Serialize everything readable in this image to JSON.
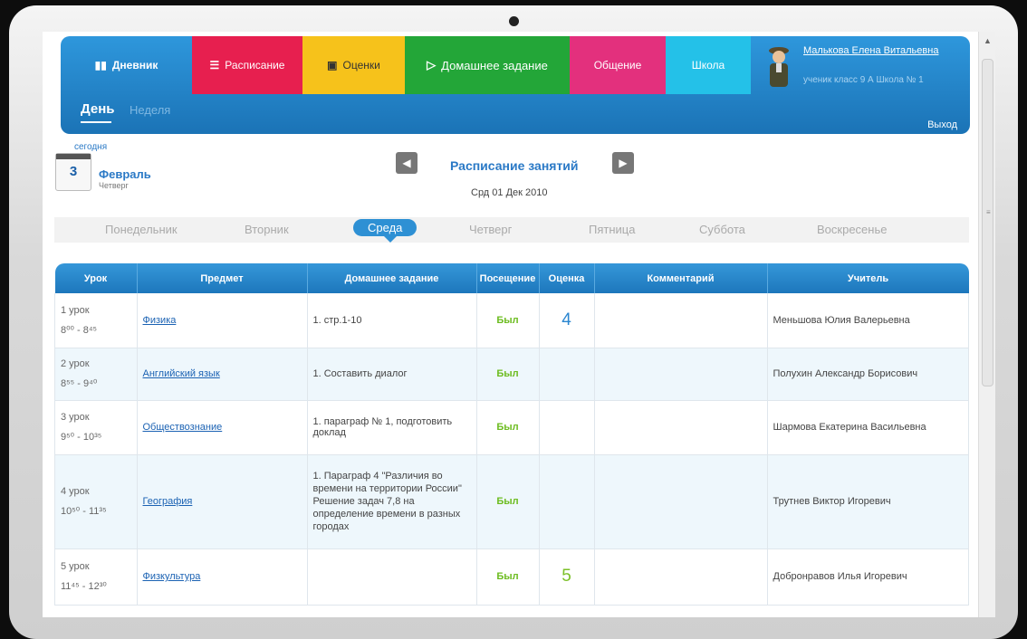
{
  "nav": {
    "tabs": [
      {
        "label": "Дневник"
      },
      {
        "label": "Расписание"
      },
      {
        "label": "Оценки"
      },
      {
        "label": "Домашнее задание"
      },
      {
        "label": "Общение"
      },
      {
        "label": "Школа"
      }
    ],
    "sub_tabs": {
      "day": "День",
      "week": "Неделя"
    },
    "user": {
      "name": "Малькова Елена Витальевна",
      "info": "ученик класс 9 А   Школа № 1"
    },
    "exit": "Выход"
  },
  "calendar": {
    "today": "сегодня",
    "day": "3",
    "month": "Февраль",
    "weekday": "Четверг"
  },
  "schedule": {
    "title": "Расписание занятий",
    "date": "Срд 01 Дек 2010"
  },
  "days": [
    {
      "label": "Понедельник"
    },
    {
      "label": "Вторник"
    },
    {
      "label": "Среда"
    },
    {
      "label": "Четверг"
    },
    {
      "label": "Пятница"
    },
    {
      "label": "Суббота"
    },
    {
      "label": "Воскресенье"
    }
  ],
  "table": {
    "headers": [
      "Урок",
      "Предмет",
      "Домашнее задание",
      "Посещение",
      "Оценка",
      "Комментарий",
      "Учитель"
    ],
    "rows": [
      {
        "lesson": "1 урок",
        "time": "8⁰⁰ - 8⁴⁵",
        "subject": "Физика",
        "homework": "1. стр.1-10",
        "attendance": "Был",
        "grade": "4",
        "comment": "",
        "teacher": "Меньшова Юлия Валерьевна"
      },
      {
        "lesson": "2 урок",
        "time": "8⁵⁵ - 9⁴⁰",
        "subject": "Английский язык",
        "homework": "1. Составить диалог",
        "attendance": "Был",
        "grade": "",
        "comment": "",
        "teacher": "Полухин Александр Борисович"
      },
      {
        "lesson": "3 урок",
        "time": "9⁵⁰ - 10³⁵",
        "subject": "Обществознание",
        "homework": "1. параграф № 1, подготовить доклад",
        "attendance": "Был",
        "grade": "",
        "comment": "",
        "teacher": "Шармова Екатерина Васильевна"
      },
      {
        "lesson": "4 урок",
        "time": "10⁵⁰ - 11³⁵",
        "subject": "География",
        "homework": "1. Параграф 4 \"Различия во времени на территории России\" Решение задач 7,8 на определение времени в разных городах",
        "attendance": "Был",
        "grade": "",
        "comment": "",
        "teacher": "Трутнев Виктор Игоревич"
      },
      {
        "lesson": "5 урок",
        "time": "11⁴⁵ - 12³⁰",
        "subject": "Физкультура",
        "homework": "",
        "attendance": "Был",
        "grade": "5",
        "comment": "",
        "teacher": "Добронравов Илья Игоревич"
      }
    ]
  }
}
